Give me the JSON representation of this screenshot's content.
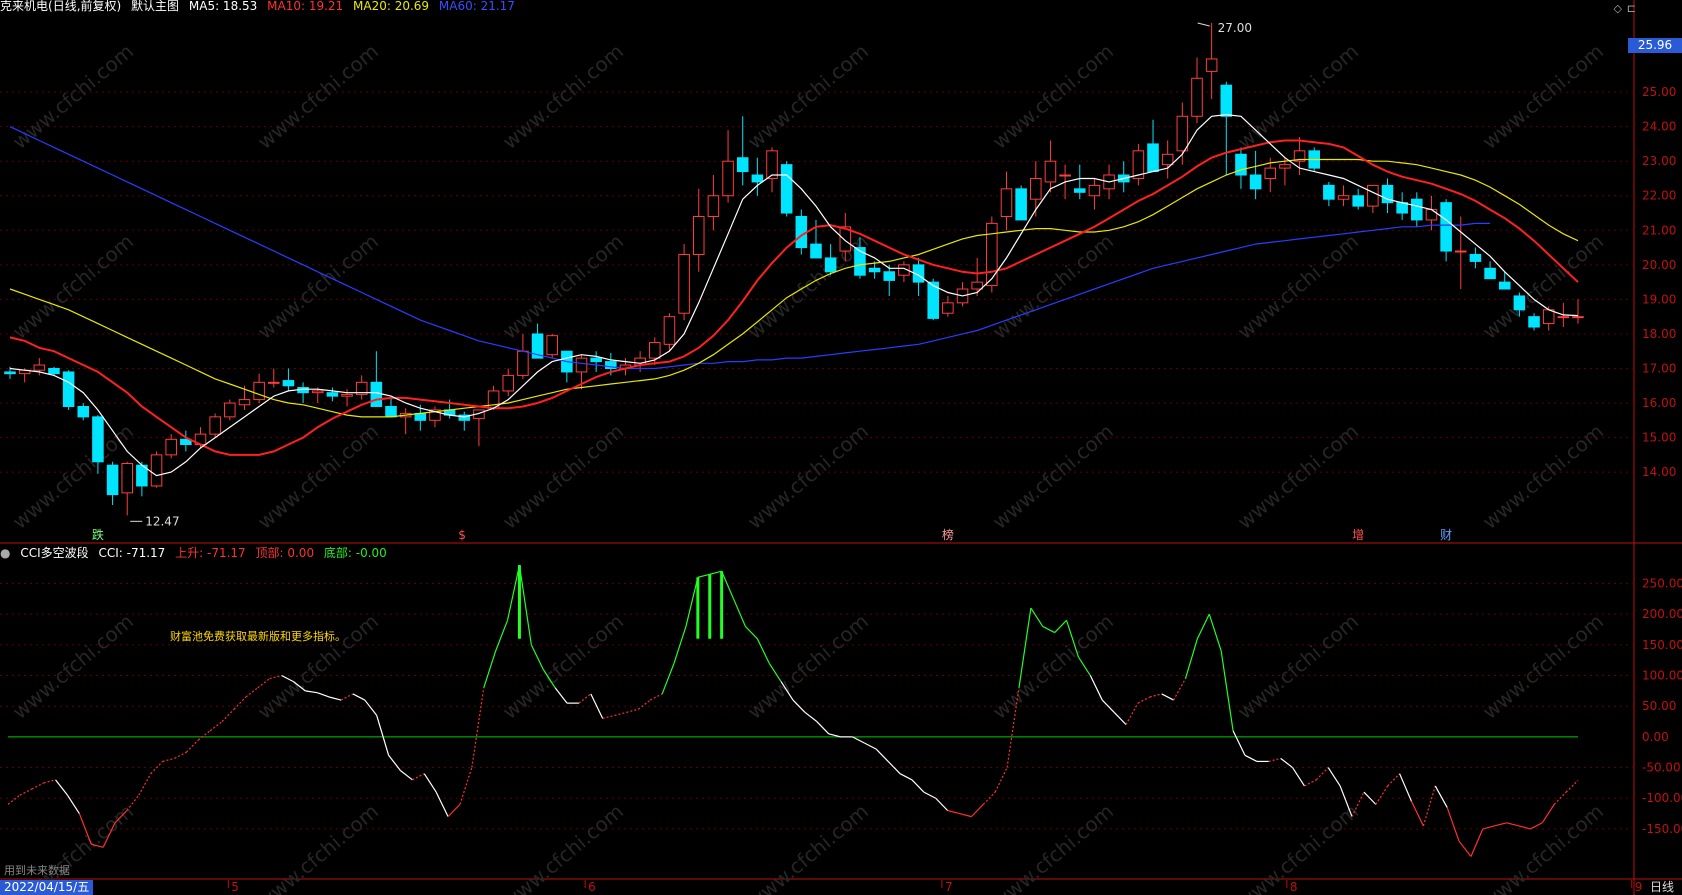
{
  "header": {
    "stock_name": "克来机电",
    "period_mode": "(日线,前复权)",
    "main_chart": "默认主图",
    "ma5_label": "MA5: 18.53",
    "ma10_label": "MA10: 19.21",
    "ma20_label": "MA20: 20.69",
    "ma60_label": "MA60: 21.17"
  },
  "indicator_header": {
    "name": "CCI多空波段",
    "cci_label": "CCI: -71.17",
    "rise_label": "上升: -71.17",
    "top_label": "顶部: 0.00",
    "bottom_label": "底部: -0.00"
  },
  "note_text": "财富池免费获取最新版和更多指标。",
  "future_data_text": "用到未来数据",
  "current_date": "2022/04/15/五",
  "period_label": "日线",
  "current_price_box": "25.96",
  "high_marker": "27.00",
  "low_marker": "12.47",
  "event_marks": [
    "跌",
    "$",
    "榜",
    "增",
    "财"
  ],
  "month_labels": [
    "5",
    "6",
    "7",
    "8",
    "9"
  ],
  "watermark": "www.cfchi.com",
  "colors": {
    "up": "#ff3d3d",
    "down": "#00e5ff",
    "ma5": "#ffffff",
    "ma10": "#ff2020",
    "ma20": "#e8e800",
    "ma60": "#2a3dff",
    "cci_up": "#ff3030",
    "cci_mid": "#ffffff",
    "cci_top": "#22ff22",
    "zero_line": "#00cc00",
    "axis": "#c01010"
  },
  "chart_data": [
    {
      "type": "candlestick",
      "title": "克来机电 (日线,前复权)",
      "price_range": [
        12.47,
        27.0
      ],
      "y_ticks": [
        14.0,
        15.0,
        16.0,
        17.0,
        18.0,
        19.0,
        20.0,
        21.0,
        22.0,
        23.0,
        24.0,
        25.0
      ],
      "ohlc": [
        [
          16.9,
          17.05,
          16.7,
          16.85
        ],
        [
          16.85,
          17.0,
          16.6,
          16.95
        ],
        [
          16.95,
          17.3,
          16.8,
          17.1
        ],
        [
          17.0,
          17.05,
          16.8,
          16.85
        ],
        [
          16.9,
          16.95,
          15.8,
          15.9
        ],
        [
          15.9,
          16.0,
          15.5,
          15.6
        ],
        [
          15.6,
          15.65,
          13.95,
          14.3
        ],
        [
          14.2,
          14.3,
          13.05,
          13.35
        ],
        [
          13.4,
          14.3,
          12.75,
          14.25
        ],
        [
          14.2,
          14.3,
          13.3,
          13.6
        ],
        [
          13.6,
          14.6,
          13.55,
          14.5
        ],
        [
          14.5,
          15.1,
          14.4,
          14.95
        ],
        [
          14.95,
          15.2,
          14.6,
          14.8
        ],
        [
          14.8,
          15.3,
          14.7,
          15.1
        ],
        [
          15.1,
          15.7,
          15.0,
          15.6
        ],
        [
          15.6,
          16.1,
          15.5,
          16.0
        ],
        [
          15.95,
          16.5,
          15.8,
          16.1
        ],
        [
          16.1,
          16.85,
          16.0,
          16.6
        ],
        [
          16.6,
          17.0,
          16.45,
          16.6
        ],
        [
          16.65,
          17.0,
          16.35,
          16.5
        ],
        [
          16.45,
          16.6,
          16.0,
          16.3
        ],
        [
          16.3,
          16.45,
          16.0,
          16.35
        ],
        [
          16.3,
          16.45,
          16.05,
          16.2
        ],
        [
          16.2,
          16.4,
          15.9,
          16.25
        ],
        [
          16.25,
          16.8,
          16.1,
          16.6
        ],
        [
          16.6,
          17.5,
          16.3,
          15.9
        ],
        [
          15.9,
          16.15,
          15.6,
          15.6
        ],
        [
          15.6,
          15.85,
          15.1,
          15.7
        ],
        [
          15.7,
          15.95,
          15.2,
          15.5
        ],
        [
          15.5,
          15.9,
          15.3,
          15.8
        ],
        [
          15.8,
          16.1,
          15.55,
          15.65
        ],
        [
          15.65,
          15.75,
          15.2,
          15.5
        ],
        [
          15.55,
          15.8,
          14.75,
          15.8
        ],
        [
          15.85,
          16.5,
          15.8,
          16.35
        ],
        [
          16.35,
          17.0,
          16.2,
          16.8
        ],
        [
          16.8,
          18.0,
          16.7,
          17.5
        ],
        [
          18.0,
          18.3,
          17.3,
          17.3
        ],
        [
          17.4,
          18.0,
          17.3,
          17.95
        ],
        [
          17.5,
          17.5,
          16.6,
          16.9
        ],
        [
          16.9,
          17.4,
          16.4,
          17.3
        ],
        [
          17.3,
          17.5,
          16.9,
          17.2
        ],
        [
          17.2,
          17.45,
          16.8,
          17.0
        ],
        [
          17.0,
          17.3,
          16.8,
          17.1
        ],
        [
          17.1,
          17.5,
          16.9,
          17.3
        ],
        [
          17.3,
          17.9,
          17.1,
          17.75
        ],
        [
          17.7,
          18.6,
          17.5,
          18.5
        ],
        [
          18.6,
          20.6,
          18.4,
          20.3
        ],
        [
          20.3,
          22.2,
          19.8,
          21.4
        ],
        [
          21.4,
          22.6,
          21.0,
          22.0
        ],
        [
          22.0,
          23.9,
          21.8,
          23.0
        ],
        [
          23.1,
          24.3,
          22.3,
          22.7
        ],
        [
          22.6,
          23.1,
          22.0,
          22.4
        ],
        [
          22.5,
          23.4,
          22.1,
          23.3
        ],
        [
          22.9,
          23.0,
          21.4,
          21.5
        ],
        [
          21.4,
          21.6,
          20.3,
          20.5
        ],
        [
          20.6,
          21.3,
          20.2,
          20.2
        ],
        [
          20.2,
          20.6,
          19.7,
          19.8
        ],
        [
          20.4,
          21.5,
          20.1,
          21.1
        ],
        [
          20.5,
          20.8,
          19.6,
          19.7
        ],
        [
          19.9,
          20.1,
          19.6,
          19.8
        ],
        [
          19.8,
          20.0,
          19.1,
          19.55
        ],
        [
          19.7,
          20.1,
          19.5,
          20.0
        ],
        [
          20.0,
          20.2,
          19.1,
          19.5
        ],
        [
          19.5,
          19.6,
          18.4,
          18.45
        ],
        [
          18.6,
          19.1,
          18.5,
          18.9
        ],
        [
          18.9,
          19.5,
          18.8,
          19.3
        ],
        [
          19.3,
          20.2,
          19.1,
          19.5
        ],
        [
          19.4,
          21.4,
          19.2,
          21.2
        ],
        [
          21.4,
          22.7,
          21.0,
          22.2
        ],
        [
          22.2,
          22.3,
          21.6,
          21.3
        ],
        [
          21.9,
          23.0,
          21.4,
          22.5
        ],
        [
          22.4,
          23.6,
          22.1,
          23.0
        ],
        [
          22.6,
          22.9,
          21.9,
          22.6
        ],
        [
          22.2,
          22.9,
          21.9,
          22.1
        ],
        [
          22.0,
          22.5,
          21.6,
          22.3
        ],
        [
          22.2,
          22.9,
          21.9,
          22.6
        ],
        [
          22.6,
          23.0,
          22.1,
          22.4
        ],
        [
          22.5,
          23.5,
          22.3,
          23.3
        ],
        [
          23.5,
          24.2,
          23.0,
          22.7
        ],
        [
          22.9,
          23.6,
          22.5,
          23.2
        ],
        [
          23.3,
          24.7,
          22.9,
          24.3
        ],
        [
          24.3,
          26.0,
          24.1,
          25.4
        ],
        [
          25.6,
          27.0,
          24.8,
          25.96
        ],
        [
          25.2,
          25.3,
          22.6,
          24.3
        ],
        [
          23.2,
          23.4,
          22.2,
          22.6
        ],
        [
          22.6,
          23.3,
          21.9,
          22.2
        ],
        [
          22.5,
          23.1,
          22.1,
          22.8
        ],
        [
          22.8,
          23.1,
          22.3,
          22.9
        ],
        [
          23.0,
          23.7,
          22.6,
          23.3
        ],
        [
          23.3,
          23.4,
          22.7,
          22.8
        ],
        [
          22.3,
          22.4,
          21.7,
          21.9
        ],
        [
          21.9,
          22.3,
          21.7,
          22.0
        ],
        [
          22.0,
          22.2,
          21.6,
          21.7
        ],
        [
          21.7,
          22.3,
          21.5,
          22.3
        ],
        [
          22.3,
          22.5,
          21.5,
          21.8
        ],
        [
          21.8,
          22.1,
          21.3,
          21.5
        ],
        [
          21.9,
          22.1,
          21.1,
          21.3
        ],
        [
          21.3,
          22.0,
          21.0,
          21.6
        ],
        [
          21.8,
          21.9,
          20.1,
          20.4
        ],
        [
          20.4,
          21.4,
          19.3,
          20.4
        ],
        [
          20.3,
          20.5,
          19.9,
          20.1
        ],
        [
          19.9,
          20.1,
          19.6,
          19.6
        ],
        [
          19.5,
          19.8,
          19.3,
          19.3
        ],
        [
          19.1,
          19.2,
          18.5,
          18.7
        ],
        [
          18.5,
          18.6,
          18.1,
          18.2
        ],
        [
          18.3,
          18.8,
          18.1,
          18.7
        ],
        [
          18.5,
          18.9,
          18.2,
          18.5
        ],
        [
          18.5,
          19.0,
          18.3,
          18.5
        ]
      ],
      "ma5": [
        17.0,
        16.95,
        16.9,
        16.8,
        16.6,
        16.3,
        15.8,
        15.2,
        14.6,
        14.2,
        13.9,
        14.0,
        14.3,
        14.7,
        15.0,
        15.3,
        15.6,
        15.9,
        16.2,
        16.35,
        16.4,
        16.4,
        16.35,
        16.3,
        16.3,
        16.3,
        16.2,
        16.0,
        15.85,
        15.75,
        15.65,
        15.6,
        15.7,
        15.85,
        16.1,
        16.5,
        16.9,
        17.2,
        17.3,
        17.4,
        17.35,
        17.25,
        17.2,
        17.15,
        17.25,
        17.5,
        18.0,
        18.9,
        19.9,
        20.9,
        21.9,
        22.3,
        22.6,
        22.6,
        22.2,
        21.7,
        21.1,
        20.7,
        20.4,
        20.2,
        19.9,
        19.9,
        19.7,
        19.4,
        19.2,
        19.1,
        19.2,
        19.6,
        20.2,
        20.9,
        21.6,
        22.2,
        22.4,
        22.5,
        22.5,
        22.4,
        22.5,
        22.6,
        22.7,
        22.8,
        23.2,
        23.9,
        24.3,
        24.35,
        24.3,
        23.9,
        23.5,
        23.1,
        22.8,
        22.7,
        22.6,
        22.5,
        22.3,
        22.1,
        21.9,
        21.8,
        21.7,
        21.6,
        21.3,
        20.95,
        20.6,
        20.25,
        19.8,
        19.4,
        19.0,
        18.7,
        18.55,
        18.53
      ],
      "ma10": [
        17.9,
        17.8,
        17.6,
        17.5,
        17.3,
        17.1,
        16.9,
        16.6,
        16.3,
        15.9,
        15.6,
        15.3,
        15.0,
        14.8,
        14.6,
        14.5,
        14.5,
        14.5,
        14.6,
        14.8,
        15.0,
        15.3,
        15.55,
        15.75,
        15.95,
        16.1,
        16.15,
        16.15,
        16.1,
        16.05,
        16.0,
        15.95,
        15.9,
        15.85,
        15.85,
        15.9,
        16.0,
        16.15,
        16.35,
        16.55,
        16.75,
        16.9,
        17.0,
        17.1,
        17.15,
        17.2,
        17.35,
        17.6,
        17.95,
        18.4,
        18.95,
        19.55,
        20.05,
        20.5,
        20.85,
        21.1,
        21.15,
        21.05,
        20.9,
        20.7,
        20.5,
        20.3,
        20.15,
        20.0,
        19.9,
        19.8,
        19.75,
        19.8,
        19.9,
        20.1,
        20.3,
        20.5,
        20.7,
        20.9,
        21.1,
        21.35,
        21.6,
        21.85,
        22.05,
        22.3,
        22.55,
        22.85,
        23.1,
        23.25,
        23.35,
        23.45,
        23.55,
        23.6,
        23.6,
        23.55,
        23.5,
        23.4,
        23.15,
        22.9,
        22.7,
        22.55,
        22.45,
        22.35,
        22.2,
        22.05,
        21.85,
        21.6,
        21.35,
        21.05,
        20.7,
        20.3,
        19.9,
        19.5
      ],
      "ma20": [
        19.3,
        19.15,
        19.0,
        18.85,
        18.7,
        18.5,
        18.3,
        18.1,
        17.9,
        17.7,
        17.5,
        17.3,
        17.1,
        16.9,
        16.7,
        16.55,
        16.4,
        16.25,
        16.1,
        16.0,
        15.95,
        15.85,
        15.75,
        15.65,
        15.6,
        15.6,
        15.6,
        15.65,
        15.7,
        15.75,
        15.8,
        15.85,
        15.9,
        15.95,
        16.0,
        16.1,
        16.2,
        16.3,
        16.4,
        16.45,
        16.5,
        16.55,
        16.6,
        16.65,
        16.7,
        16.8,
        16.95,
        17.15,
        17.4,
        17.7,
        18.0,
        18.35,
        18.7,
        19.05,
        19.3,
        19.55,
        19.75,
        19.9,
        20.0,
        20.05,
        20.1,
        20.2,
        20.3,
        20.45,
        20.6,
        20.75,
        20.85,
        20.9,
        20.95,
        21.0,
        21.05,
        21.05,
        21.0,
        20.95,
        20.95,
        21.0,
        21.1,
        21.25,
        21.45,
        21.7,
        21.95,
        22.2,
        22.4,
        22.6,
        22.75,
        22.85,
        22.95,
        23.0,
        23.05,
        23.05,
        23.05,
        23.05,
        23.05,
        23.0,
        23.0,
        22.95,
        22.9,
        22.8,
        22.7,
        22.6,
        22.45,
        22.25,
        22.0,
        21.75,
        21.45,
        21.15,
        20.9,
        20.7
      ],
      "ma60": [
        24.0,
        23.8,
        23.6,
        23.4,
        23.2,
        23.0,
        22.8,
        22.6,
        22.4,
        22.2,
        22.0,
        21.8,
        21.6,
        21.4,
        21.2,
        21.0,
        20.8,
        20.6,
        20.4,
        20.2,
        20.0,
        19.8,
        19.6,
        19.4,
        19.2,
        19.0,
        18.8,
        18.6,
        18.4,
        18.25,
        18.1,
        17.95,
        17.8,
        17.7,
        17.6,
        17.5,
        17.4,
        17.3,
        17.2,
        17.15,
        17.1,
        17.05,
        17.0,
        17.0,
        17.0,
        17.05,
        17.1,
        17.15,
        17.15,
        17.2,
        17.2,
        17.25,
        17.25,
        17.3,
        17.3,
        17.35,
        17.4,
        17.45,
        17.5,
        17.55,
        17.6,
        17.65,
        17.7,
        17.8,
        17.9,
        18.0,
        18.1,
        18.25,
        18.4,
        18.55,
        18.7,
        18.85,
        19.0,
        19.15,
        19.3,
        19.45,
        19.6,
        19.75,
        19.9,
        20.0,
        20.1,
        20.2,
        20.3,
        20.4,
        20.5,
        20.6,
        20.65,
        20.7,
        20.75,
        20.8,
        20.85,
        20.9,
        20.95,
        21.0,
        21.05,
        21.1,
        21.1,
        21.15,
        21.15,
        21.15,
        21.2,
        21.2
      ]
    },
    {
      "type": "line",
      "title": "CCI多空波段",
      "y_ticks": [
        -150.0,
        -100.0,
        -50.0,
        0.0,
        50.0,
        100.0,
        150.0,
        200.0,
        250.0
      ],
      "ylim": [
        -230,
        285
      ],
      "cci": [
        -110,
        -95,
        -85,
        -75,
        -70,
        -95,
        -125,
        -175,
        -180,
        -140,
        -120,
        -95,
        -60,
        -40,
        -35,
        -25,
        -5,
        10,
        25,
        45,
        65,
        80,
        95,
        100,
        90,
        75,
        72,
        65,
        60,
        70,
        60,
        35,
        -30,
        -55,
        -70,
        -60,
        -90,
        -130,
        -110,
        -50,
        80,
        140,
        190,
        280,
        150,
        110,
        80,
        55,
        55,
        70,
        30,
        35,
        40,
        45,
        60,
        70,
        120,
        180,
        260,
        265,
        270,
        225,
        180,
        160,
        120,
        90,
        60,
        40,
        25,
        5,
        0,
        0,
        -10,
        -20,
        -40,
        -60,
        -70,
        -90,
        -100,
        -120,
        -125,
        -130,
        -110,
        -90,
        -50,
        80,
        210,
        180,
        170,
        190,
        130,
        100,
        60,
        40,
        20,
        55,
        65,
        70,
        60,
        95,
        160,
        200,
        140,
        10,
        -30,
        -40,
        -40,
        -35,
        -50,
        -80,
        -70,
        -50,
        -80,
        -130,
        -90,
        -110,
        -80,
        -60,
        -105,
        -145,
        -80,
        -115,
        -170,
        -195,
        -150,
        -145,
        -140,
        -145,
        -150,
        -140,
        -110,
        -90,
        -71
      ]
    }
  ]
}
